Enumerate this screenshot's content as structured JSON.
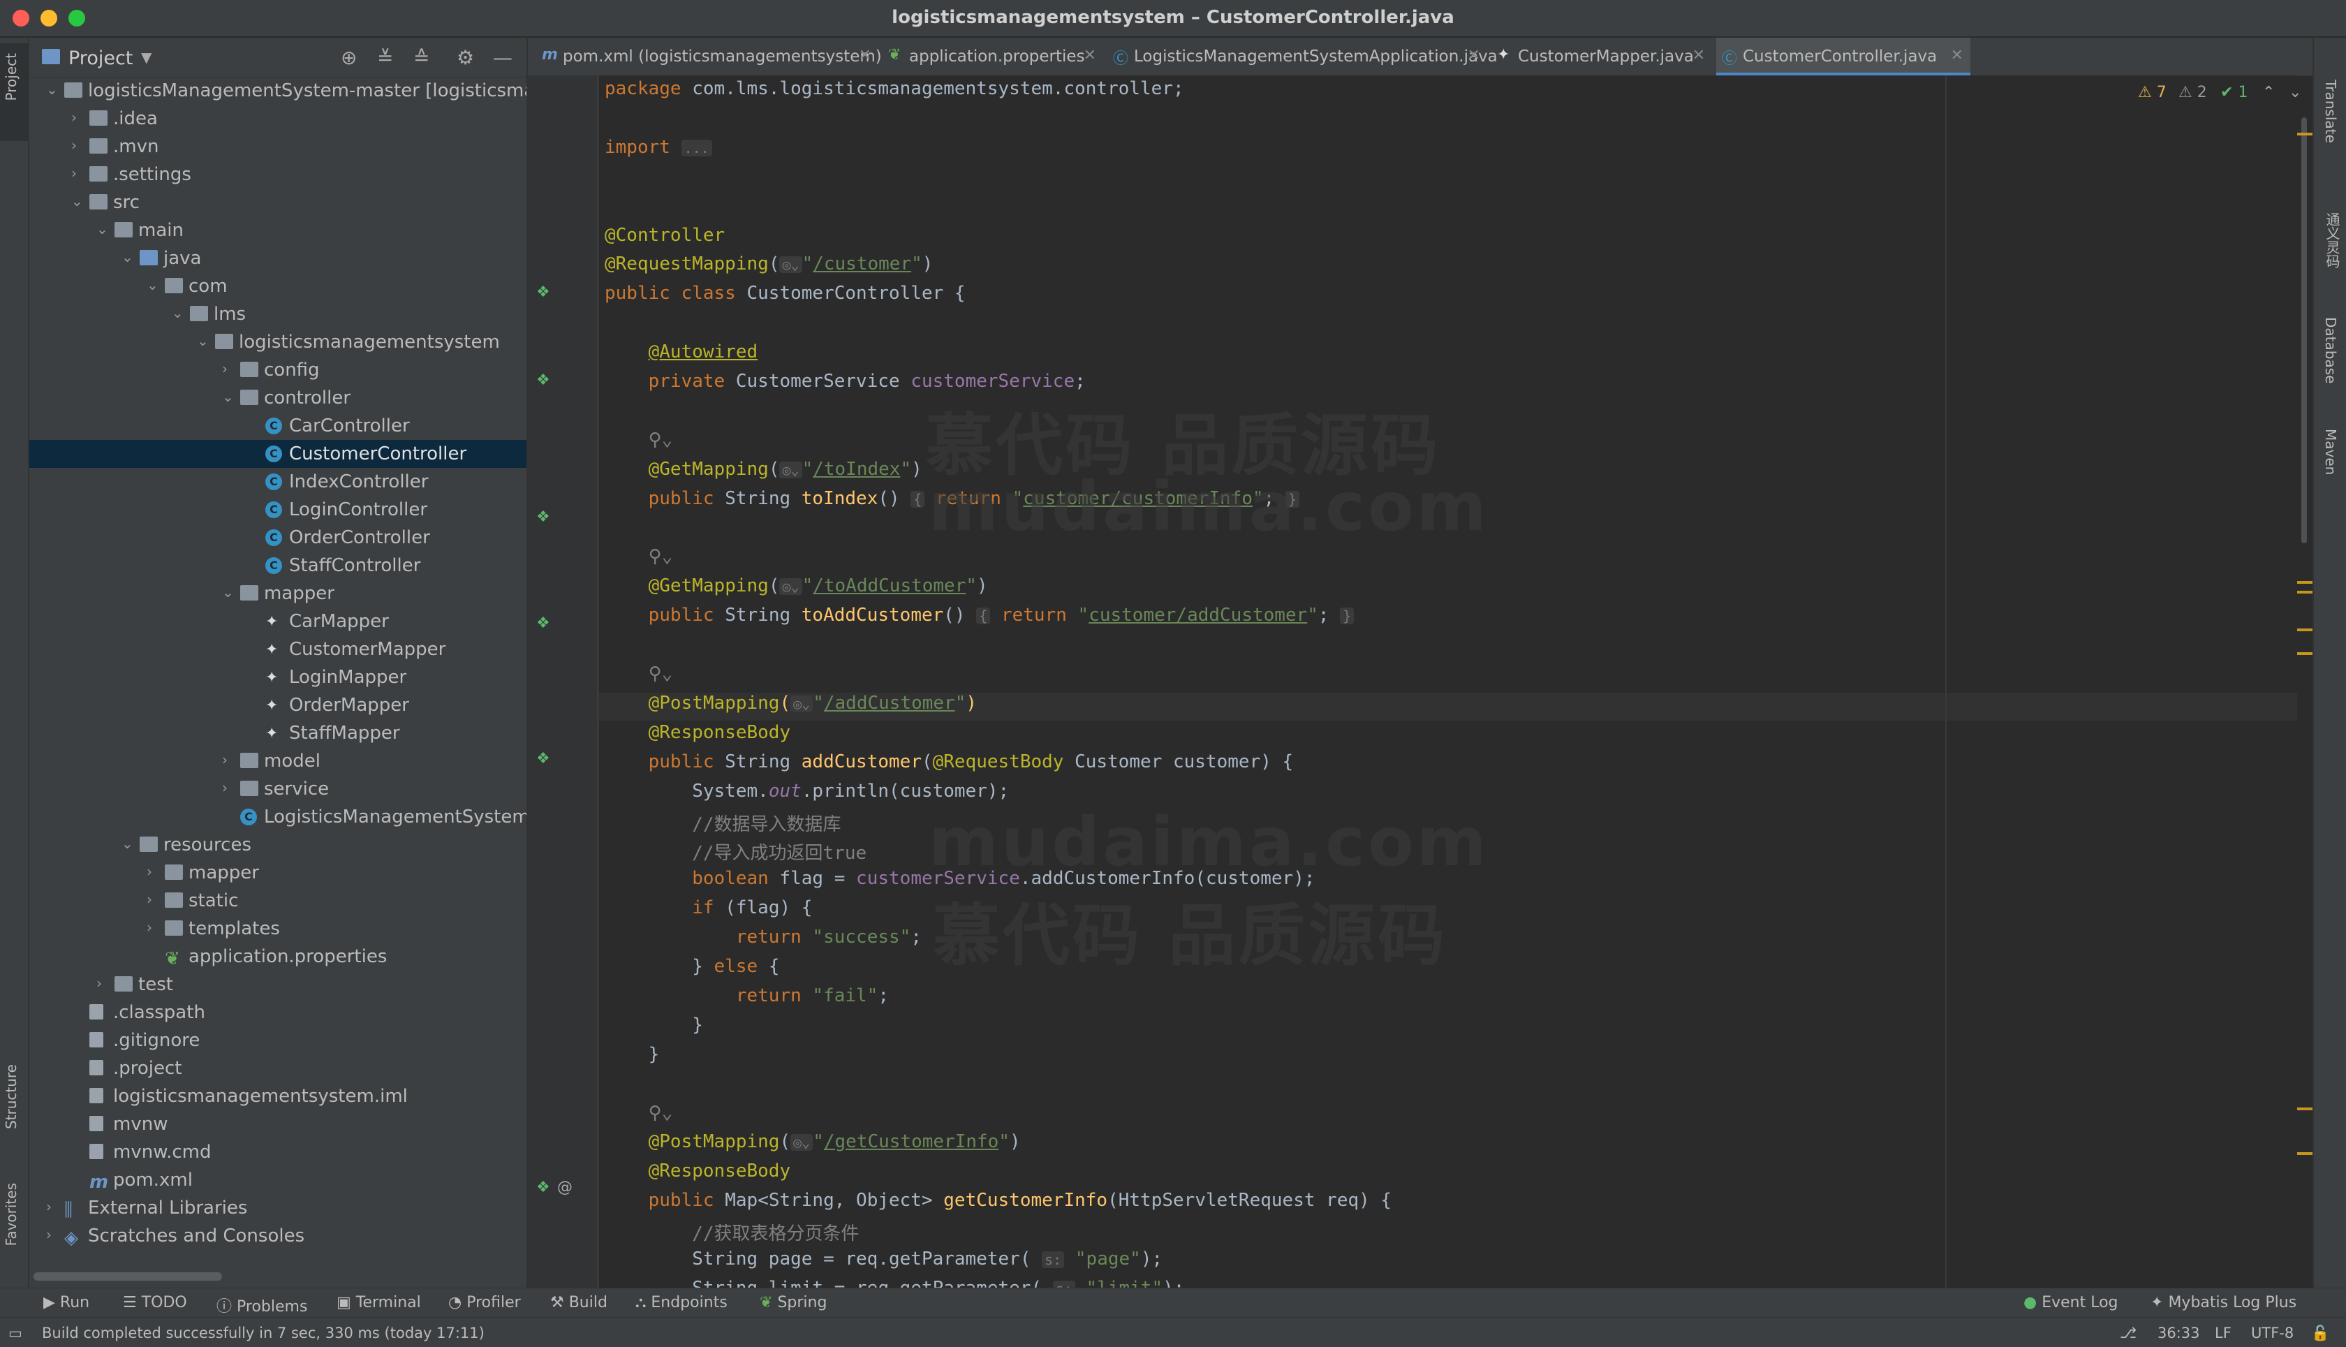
{
  "window": {
    "title": "logisticsmanagementsystem – CustomerController.java"
  },
  "left_strip": {
    "project": "Project",
    "structure": "Structure",
    "favorites": "Favorites"
  },
  "project_panel": {
    "label": "Project"
  },
  "tree": [
    {
      "label": "logisticsManagementSystem-master [logisticsma",
      "depth": 0,
      "arrow": "open",
      "icon": "folder"
    },
    {
      "label": ".idea",
      "depth": 1,
      "arrow": "closed",
      "icon": "folder"
    },
    {
      "label": ".mvn",
      "depth": 1,
      "arrow": "closed",
      "icon": "folder"
    },
    {
      "label": ".settings",
      "depth": 1,
      "arrow": "closed",
      "icon": "folder"
    },
    {
      "label": "src",
      "depth": 1,
      "arrow": "open",
      "icon": "folder"
    },
    {
      "label": "main",
      "depth": 2,
      "arrow": "open",
      "icon": "folder"
    },
    {
      "label": "java",
      "depth": 3,
      "arrow": "open",
      "icon": "folder-blue"
    },
    {
      "label": "com",
      "depth": 4,
      "arrow": "open",
      "icon": "folder"
    },
    {
      "label": "lms",
      "depth": 5,
      "arrow": "open",
      "icon": "folder"
    },
    {
      "label": "logisticsmanagementsystem",
      "depth": 6,
      "arrow": "open",
      "icon": "folder"
    },
    {
      "label": "config",
      "depth": 7,
      "arrow": "closed",
      "icon": "folder"
    },
    {
      "label": "controller",
      "depth": 7,
      "arrow": "open",
      "icon": "folder"
    },
    {
      "label": "CarController",
      "depth": 8,
      "arrow": "",
      "icon": "class"
    },
    {
      "label": "CustomerController",
      "depth": 8,
      "arrow": "",
      "icon": "class",
      "selected": true
    },
    {
      "label": "IndexController",
      "depth": 8,
      "arrow": "",
      "icon": "class"
    },
    {
      "label": "LoginController",
      "depth": 8,
      "arrow": "",
      "icon": "class"
    },
    {
      "label": "OrderController",
      "depth": 8,
      "arrow": "",
      "icon": "class"
    },
    {
      "label": "StaffController",
      "depth": 8,
      "arrow": "",
      "icon": "class"
    },
    {
      "label": "mapper",
      "depth": 7,
      "arrow": "open",
      "icon": "folder"
    },
    {
      "label": "CarMapper",
      "depth": 8,
      "arrow": "",
      "icon": "mapper"
    },
    {
      "label": "CustomerMapper",
      "depth": 8,
      "arrow": "",
      "icon": "mapper"
    },
    {
      "label": "LoginMapper",
      "depth": 8,
      "arrow": "",
      "icon": "mapper"
    },
    {
      "label": "OrderMapper",
      "depth": 8,
      "arrow": "",
      "icon": "mapper"
    },
    {
      "label": "StaffMapper",
      "depth": 8,
      "arrow": "",
      "icon": "mapper"
    },
    {
      "label": "model",
      "depth": 7,
      "arrow": "closed",
      "icon": "folder"
    },
    {
      "label": "service",
      "depth": 7,
      "arrow": "closed",
      "icon": "folder"
    },
    {
      "label": "LogisticsManagementSystemA",
      "depth": 7,
      "arrow": "",
      "icon": "class"
    },
    {
      "label": "resources",
      "depth": 3,
      "arrow": "open",
      "icon": "folder"
    },
    {
      "label": "mapper",
      "depth": 4,
      "arrow": "closed",
      "icon": "folder"
    },
    {
      "label": "static",
      "depth": 4,
      "arrow": "closed",
      "icon": "folder"
    },
    {
      "label": "templates",
      "depth": 4,
      "arrow": "closed",
      "icon": "folder"
    },
    {
      "label": "application.properties",
      "depth": 4,
      "arrow": "",
      "icon": "props"
    },
    {
      "label": "test",
      "depth": 2,
      "arrow": "closed",
      "icon": "folder"
    },
    {
      "label": ".classpath",
      "depth": 1,
      "arrow": "",
      "icon": "file"
    },
    {
      "label": ".gitignore",
      "depth": 1,
      "arrow": "",
      "icon": "file"
    },
    {
      "label": ".project",
      "depth": 1,
      "arrow": "",
      "icon": "file"
    },
    {
      "label": "logisticsmanagementsystem.iml",
      "depth": 1,
      "arrow": "",
      "icon": "file"
    },
    {
      "label": "mvnw",
      "depth": 1,
      "arrow": "",
      "icon": "file"
    },
    {
      "label": "mvnw.cmd",
      "depth": 1,
      "arrow": "",
      "icon": "file"
    },
    {
      "label": "pom.xml",
      "depth": 1,
      "arrow": "",
      "icon": "maven"
    },
    {
      "label": "External Libraries",
      "depth": 0,
      "arrow": "closed",
      "icon": "libs"
    },
    {
      "label": "Scratches and Consoles",
      "depth": 0,
      "arrow": "closed",
      "icon": "scratch"
    }
  ],
  "tabs": [
    {
      "label": "pom.xml (logisticsmanagementsystem)",
      "icon": "m"
    },
    {
      "label": "application.properties",
      "icon": "props"
    },
    {
      "label": "LogisticsManagementSystemApplication.java",
      "icon": "class"
    },
    {
      "label": "CustomerMapper.java",
      "icon": "mapper"
    },
    {
      "label": "CustomerController.java",
      "icon": "class",
      "active": true
    }
  ],
  "inspections": {
    "warnings": "7",
    "weak_warnings": "2",
    "ok": "1"
  },
  "code_lines": [
    {
      "line": 1,
      "html": "<span class=\"kw\">package</span> com.lms.logisticsmanagementsystem.controller;"
    },
    {
      "line": 3,
      "html": "<span class=\"kw\">import</span> <span class=\"hint\">...</span>"
    },
    {
      "line": 6,
      "html": "<span class=\"an\">@Controller</span>"
    },
    {
      "line": 7,
      "html": "<span class=\"an\">@RequestMapping</span>(<span class=\"hint\">◎⌄</span><span class=\"st\">\"<span class=\"ul\">/customer</span>\"</span>)"
    },
    {
      "line": 8,
      "html": "<span class=\"kw\">public class</span> CustomerController {"
    },
    {
      "line": 10,
      "html": "    <span class=\"an ul\">@Autowired</span>"
    },
    {
      "line": 11,
      "html": "    <span class=\"kw\">private</span> CustomerService <span class=\"fd\">customerService</span>;"
    },
    {
      "line": 13,
      "html": "    <span class=\"cm\">⚲⌄</span>"
    },
    {
      "line": 14,
      "html": "    <span class=\"an\">@GetMapping</span>(<span class=\"hint\">◎⌄</span><span class=\"st\">\"<span class=\"ul\">/toIndex</span>\"</span>)"
    },
    {
      "line": 15,
      "html": "    <span class=\"kw\">public</span> String <span class=\"fn\">toIndex</span>() <span class=\"hint\">{</span> <span class=\"kw\">return</span> <span class=\"st\">\"<span class=\"ul\">customer/customerInfo</span>\"</span>; <span class=\"hint\">}</span>"
    },
    {
      "line": 17,
      "html": "    <span class=\"cm\">⚲⌄</span>"
    },
    {
      "line": 18,
      "html": "    <span class=\"an\">@GetMapping</span>(<span class=\"hint\">◎⌄</span><span class=\"st\">\"<span class=\"ul\">/toAddCustomer</span>\"</span>)"
    },
    {
      "line": 19,
      "html": "    <span class=\"kw\">public</span> String <span class=\"fn\">toAddCustomer</span>() <span class=\"hint\">{</span> <span class=\"kw\">return</span> <span class=\"st\">\"<span class=\"ul\">customer/addCustomer</span>\"</span>; <span class=\"hint\">}</span>"
    },
    {
      "line": 21,
      "html": "    <span class=\"cm\">⚲⌄</span>"
    },
    {
      "line": 22,
      "html": "    <span class=\"an\">@PostMapping</span><span class=\"fn\">(</span><span class=\"hint\">◎⌄</span><span class=\"st\">\"<span class=\"ul\">/addCustomer</span>\"</span><span class=\"fn\">)</span>",
      "current": true
    },
    {
      "line": 23,
      "html": "    <span class=\"an\">@ResponseBody</span>"
    },
    {
      "line": 24,
      "html": "    <span class=\"kw\">public</span> String <span class=\"fn\">addCustomer</span>(<span class=\"an\">@RequestBody</span> Customer customer) {"
    },
    {
      "line": 25,
      "html": "        System.<span class=\"it\">out</span>.println(customer);"
    },
    {
      "line": 26,
      "html": "        <span class=\"cm\">//数据导入数据库</span>"
    },
    {
      "line": 27,
      "html": "        <span class=\"cm\">//导入成功返回true</span>"
    },
    {
      "line": 28,
      "html": "        <span class=\"kw\">boolean</span> flag = <span class=\"fd\">customerService</span>.addCustomerInfo(customer);"
    },
    {
      "line": 29,
      "html": "        <span class=\"kw\">if</span> (flag) {"
    },
    {
      "line": 30,
      "html": "            <span class=\"kw\">return</span> <span class=\"st\">\"success\"</span>;"
    },
    {
      "line": 31,
      "html": "        } <span class=\"kw\">else</span> {"
    },
    {
      "line": 32,
      "html": "            <span class=\"kw\">return</span> <span class=\"st\">\"fail\"</span>;"
    },
    {
      "line": 33,
      "html": "        }"
    },
    {
      "line": 34,
      "html": "    }"
    },
    {
      "line": 36,
      "html": "    <span class=\"cm\">⚲⌄</span>"
    },
    {
      "line": 37,
      "html": "    <span class=\"an\">@PostMapping</span>(<span class=\"hint\">◎⌄</span><span class=\"st\">\"<span class=\"ul\">/getCustomerInfo</span>\"</span>)"
    },
    {
      "line": 38,
      "html": "    <span class=\"an\">@ResponseBody</span>"
    },
    {
      "line": 39,
      "html": "    <span class=\"kw\">public</span> Map&lt;String, Object&gt; <span class=\"fn\">getCustomerInfo</span>(HttpServletRequest req) {"
    },
    {
      "line": 40,
      "html": "        <span class=\"cm\">//获取表格分页条件</span>"
    },
    {
      "line": 41,
      "html": "        String page = req.getParameter( <span class=\"hint\">s:</span> <span class=\"st\">\"page\"</span>);"
    },
    {
      "line": 42,
      "html": "        String limit = req.getParameter( <span class=\"hint\">s:</span> <span class=\"st\">\"limit\"</span>);"
    }
  ],
  "watermarks": [
    "慕代码 品质源码",
    "mudaima.com",
    "mudaima.com",
    "慕代码 品质源码"
  ],
  "right_strip": {
    "translate": "Translate",
    "tongyi": "通义灵码",
    "database": "Database",
    "maven": "Maven"
  },
  "bottom_tools": [
    "Run",
    "TODO",
    "Problems",
    "Terminal",
    "Profiler",
    "Build",
    "Endpoints",
    "Spring"
  ],
  "bottom_right_tools": [
    "Event Log",
    "Mybatis Log Plus"
  ],
  "status": {
    "message": "Build completed successfully in 7 sec, 330 ms (today 17:11)",
    "position": "36:33",
    "line_sep": "LF",
    "encoding": "UTF-8"
  },
  "colors": {
    "accent": "#4a88c7",
    "keyword": "#cc7832",
    "annotation": "#bbb529",
    "string": "#6a8759",
    "selection": "#0d293e"
  }
}
